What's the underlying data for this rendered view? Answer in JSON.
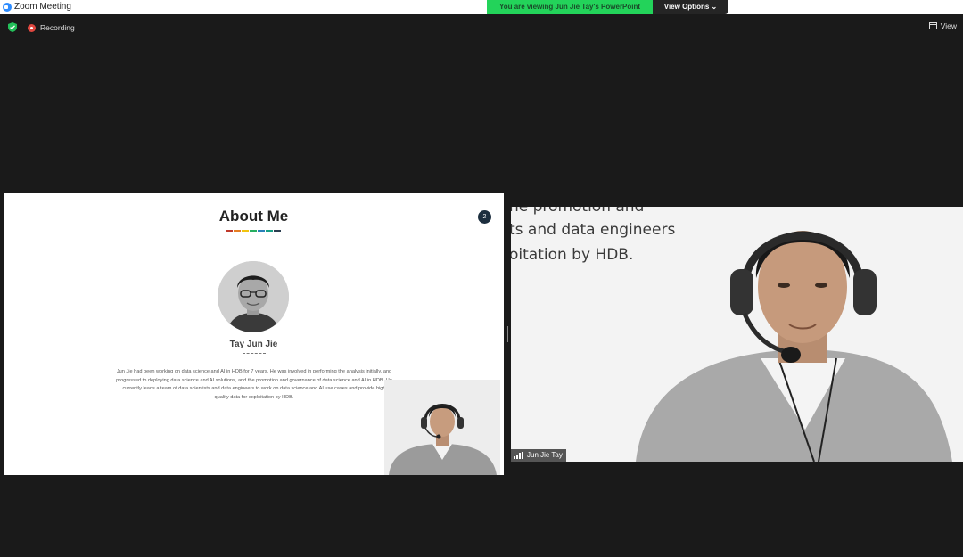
{
  "window": {
    "title": "Zoom Meeting"
  },
  "share_banner": {
    "viewing_text": "You are viewing Jun Jie Tay's PowerPoint",
    "view_options_label": "View Options ⌄"
  },
  "toolbar": {
    "recording_label": "Recording",
    "view_label": "View"
  },
  "slide": {
    "title": "About Me",
    "page_number": "2",
    "name": "Tay Jun Jie",
    "bio": "Jun Jie had been working on data science and AI in HDB for 7 years. He was involved in performing the analysis initially, and progressed to deploying data science and AI solutions, and the promotion and governance of data science and AI in HDB. He currently leads a team of data scientists and data engineers to work on data science and AI use cases and provide high quality data for exploitation by HDB.",
    "accent_colors": [
      "#c0392b",
      "#e67e22",
      "#f1c40f",
      "#27ae60",
      "#2980b9",
      "#16a085",
      "#2c3e50"
    ]
  },
  "video": {
    "participant_name": "Jun Jie Tay",
    "background_text_lines": [
      "he promotion and",
      "ts and data engineers",
      "oitation by HDB."
    ]
  },
  "icons": {
    "security": "shield-icon",
    "recording": "record-icon",
    "view": "grid-view-icon",
    "signal": "signal-icon"
  }
}
